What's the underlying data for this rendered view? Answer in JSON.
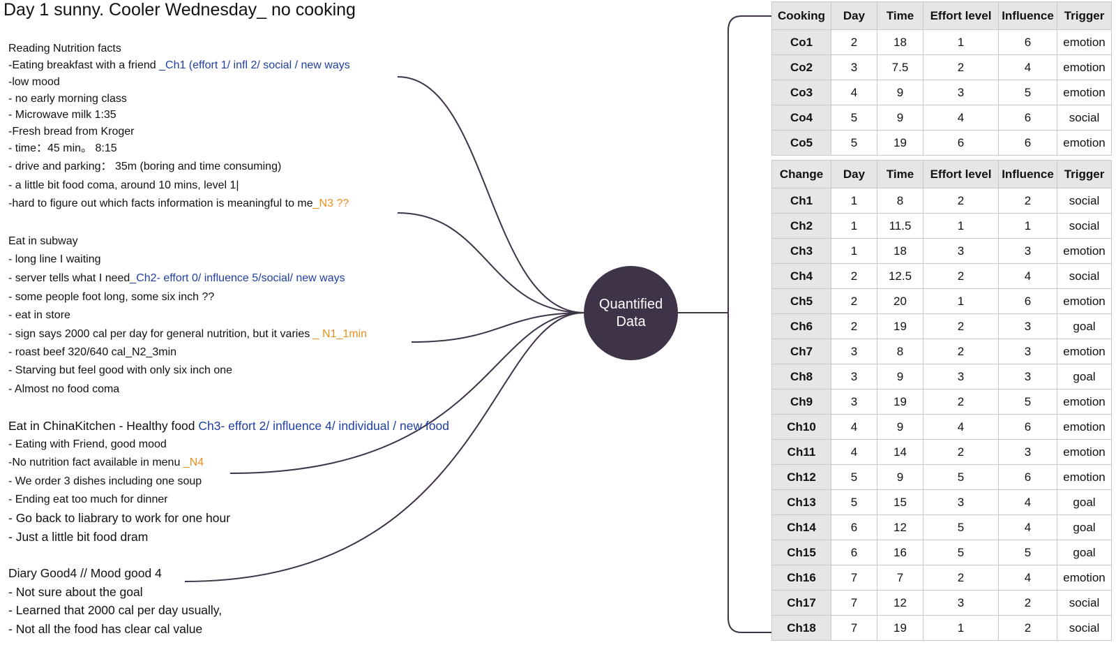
{
  "title": "Day 1 sunny. Cooler Wednesday_ no cooking",
  "hub_label": [
    "Quantified",
    "Data"
  ],
  "notes": [
    [
      {
        "t": "Reading Nutrition facts"
      }
    ],
    [
      {
        "t": "-Eating breakfast with a friend "
      },
      {
        "t": "_Ch1 (effort 1/ infl 2/ social / new ways",
        "c": "blue"
      }
    ],
    [
      {
        "t": "-low mood"
      }
    ],
    [
      {
        "t": "- no early morning class"
      }
    ],
    [
      {
        "t": "- Microwave milk  1:35"
      }
    ],
    [
      {
        "t": "-Fresh bread from Kroger"
      }
    ],
    [
      {
        "t": "- time：45 min。 8:15"
      }
    ],
    [
      {
        "t": "- drive and parking：  35m  (boring and time consuming)"
      }
    ],
    [
      {
        "t": "- a little bit food coma, around 10 mins, level 1|"
      }
    ],
    [
      {
        "t": "-hard to figure out which facts information is meaningful to me"
      },
      {
        "t": "_N3 ??",
        "c": "orange"
      }
    ],
    [
      {
        "t": "Eat in subway"
      }
    ],
    [
      {
        "t": "- long line I waiting"
      }
    ],
    [
      {
        "t": "- server tells what I need"
      },
      {
        "t": "_Ch2- effort 0/ influence 5/social/ new ways",
        "c": "blue"
      }
    ],
    [
      {
        "t": "- some people foot long, some six inch ??"
      }
    ],
    [
      {
        "t": "- eat in store"
      }
    ],
    [
      {
        "t": "- sign says 2000 cal per day for general nutrition, but it varies "
      },
      {
        "t": "_ N1_1min",
        "c": "orange"
      }
    ],
    [
      {
        "t": "- roast beef 320/640 cal_N2_3min"
      }
    ],
    [
      {
        "t": "- Starving but feel good with only six inch one"
      }
    ],
    [
      {
        "t": "- Almost no food coma"
      }
    ],
    [
      {
        "t": "Eat in ChinaKitchen - Healthy food  "
      },
      {
        "t": "Ch3- effort 2/ influence 4/ individual / new food",
        "c": "blue"
      }
    ],
    [
      {
        "t": "- Eating with Friend, good mood"
      }
    ],
    [
      {
        "t": "-No nutrition fact available in menu "
      },
      {
        "t": "_N4",
        "c": "orange"
      }
    ],
    [
      {
        "t": "- We order 3 dishes including one soup"
      }
    ],
    [
      {
        "t": "- Ending eat too much for dinner"
      }
    ],
    [
      {
        "t": "- Go back to liabrary to work for one hour"
      }
    ],
    [
      {
        "t": "- Just a little bit food dram"
      }
    ],
    [
      {
        "t": "Diary Good4 // Mood good 4"
      }
    ],
    [
      {
        "t": "- Not sure about the goal"
      }
    ],
    [
      {
        "t": "- Learned that 2000 cal per day usually,"
      }
    ],
    [
      {
        "t": "- Not all the food has clear cal value"
      }
    ]
  ],
  "colors": {
    "blue": "#1f3fa0",
    "orange": "#e8901d",
    "hub": "#3e3347",
    "wire": "#3e3347"
  },
  "cooking_table": {
    "headers": [
      "Cooking",
      "Day",
      "Time",
      "Effort level",
      "Influence",
      "Trigger"
    ],
    "rows": [
      [
        "Co1",
        "2",
        "18",
        "1",
        "6",
        "emotion"
      ],
      [
        "Co2",
        "3",
        "7.5",
        "2",
        "4",
        "emotion"
      ],
      [
        "Co3",
        "4",
        "9",
        "3",
        "5",
        "emotion"
      ],
      [
        "Co4",
        "5",
        "9",
        "4",
        "6",
        "social"
      ],
      [
        "Co5",
        "5",
        "19",
        "6",
        "6",
        "emotion"
      ]
    ]
  },
  "change_table": {
    "headers": [
      "Change",
      "Day",
      "Time",
      "Effort level",
      "Influence",
      "Trigger"
    ],
    "rows": [
      [
        "Ch1",
        "1",
        "8",
        "2",
        "2",
        "social"
      ],
      [
        "Ch2",
        "1",
        "11.5",
        "1",
        "1",
        "social"
      ],
      [
        "Ch3",
        "1",
        "18",
        "3",
        "3",
        "emotion"
      ],
      [
        "Ch4",
        "2",
        "12.5",
        "2",
        "4",
        "social"
      ],
      [
        "Ch5",
        "2",
        "20",
        "1",
        "6",
        "emotion"
      ],
      [
        "Ch6",
        "2",
        "19",
        "2",
        "3",
        "goal"
      ],
      [
        "Ch7",
        "3",
        "8",
        "2",
        "3",
        "emotion"
      ],
      [
        "Ch8",
        "3",
        "9",
        "3",
        "3",
        "goal"
      ],
      [
        "Ch9",
        "3",
        "19",
        "2",
        "5",
        "emotion"
      ],
      [
        "Ch10",
        "4",
        "9",
        "4",
        "6",
        "emotion"
      ],
      [
        "Ch11",
        "4",
        "14",
        "2",
        "3",
        "emotion"
      ],
      [
        "Ch12",
        "5",
        "9",
        "5",
        "6",
        "emotion"
      ],
      [
        "Ch13",
        "5",
        "15",
        "3",
        "4",
        "goal"
      ],
      [
        "Ch14",
        "6",
        "12",
        "5",
        "4",
        "goal"
      ],
      [
        "Ch15",
        "6",
        "16",
        "5",
        "5",
        "goal"
      ],
      [
        "Ch16",
        "7",
        "7",
        "2",
        "4",
        "emotion"
      ],
      [
        "Ch17",
        "7",
        "12",
        "3",
        "2",
        "social"
      ],
      [
        "Ch18",
        "7",
        "19",
        "1",
        "2",
        "social"
      ]
    ]
  }
}
